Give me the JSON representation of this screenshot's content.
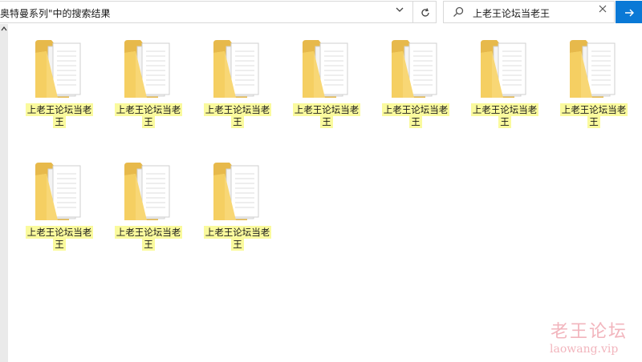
{
  "address_bar": {
    "breadcrumb": "奥特曼系列\"中的搜索结果",
    "chevron": "›",
    "dropdown_icon": "chevron-down-icon",
    "refresh_icon": "refresh-icon"
  },
  "search": {
    "query": "上老王论坛当老王",
    "clear_icon": "close-icon",
    "go_icon": "arrow-right-icon"
  },
  "folders": [
    {
      "line1": "上老王论坛当老",
      "line2": "王"
    },
    {
      "line1": "上老王论坛当老",
      "line2": "王"
    },
    {
      "line1": "上老王论坛当老",
      "line2": "王"
    },
    {
      "line1": "上老王论坛当老",
      "line2": "王"
    },
    {
      "line1": "上老王论坛当老",
      "line2": "王"
    },
    {
      "line1": "上老王论坛当老",
      "line2": "王"
    },
    {
      "line1": "上老王论坛当老",
      "line2": "王"
    },
    {
      "line1": "上老王论坛当老",
      "line2": "王"
    },
    {
      "line1": "上老王论坛当老",
      "line2": "王"
    },
    {
      "line1": "上老王论坛当老",
      "line2": "王"
    }
  ],
  "watermark": {
    "title": "老王论坛",
    "url": "laowang.vip"
  },
  "colors": {
    "accent": "#0a79d6",
    "highlight": "#fafa9d",
    "folder": "#f8d775",
    "watermark": "#f2b5bd"
  }
}
